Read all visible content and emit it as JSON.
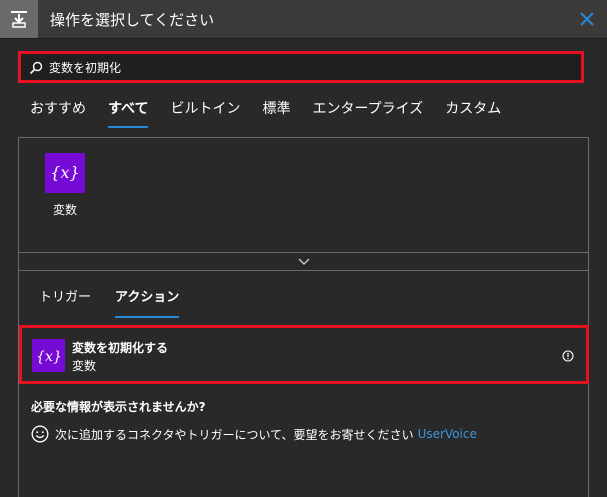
{
  "header": {
    "title": "操作を選択してください",
    "icon": "step-insert-icon",
    "close_icon": "close-icon"
  },
  "search": {
    "value": "変数を初期化",
    "icon": "search-icon"
  },
  "tabs": [
    {
      "label": "おすすめ",
      "active": false
    },
    {
      "label": "すべて",
      "active": true
    },
    {
      "label": "ビルトイン",
      "active": false
    },
    {
      "label": "標準",
      "active": false
    },
    {
      "label": "エンタープライズ",
      "active": false
    },
    {
      "label": "カスタム",
      "active": false
    }
  ],
  "connectors": [
    {
      "label": "変数",
      "icon": "variable-icon",
      "icon_text": "{x}",
      "color": "#770bd6"
    }
  ],
  "subtabs": [
    {
      "label": "トリガー",
      "active": false
    },
    {
      "label": "アクション",
      "active": true
    }
  ],
  "actions": [
    {
      "title": "変数を初期化する",
      "connector": "変数",
      "icon_text": "{x}",
      "icon": "variable-icon"
    }
  ],
  "footer": {
    "missing_title": "必要な情報が表示されませんか?",
    "feedback_text": "次に追加するコネクタやトリガーについて、要望をお寄せください",
    "link_text": "UserVoice"
  },
  "colors": {
    "accent": "#2b88d8",
    "highlight": "#e81123",
    "variable": "#770bd6",
    "background": "#292929",
    "header": "#3b3a39",
    "link": "#3a96dd"
  }
}
